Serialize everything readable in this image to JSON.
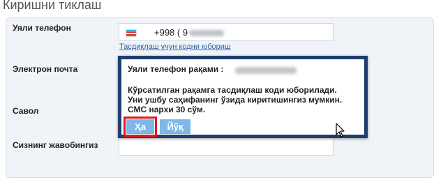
{
  "page": {
    "title": "Киришни тиклаш"
  },
  "form": {
    "phone_label": "Уяли телефон",
    "phone_prefix": "+998 ( 9",
    "resend_link": "Тасдиқлаш учун кодни юбориш",
    "email_label": "Электрон почта",
    "question_label": "Савол",
    "answer_label": "Сизнинг жавобингиз",
    "flag_icon": "uzbekistan-flag-icon"
  },
  "dialog": {
    "title": "Уяли телефон рақами :",
    "message_lines": [
      "Кўрсатилган рақамга тасдиқлаш коди юборилади.",
      "Уни ушбу саҳифанинг ўзида киритишингиз мумкин.",
      "СМС нархи 30 сўм."
    ],
    "yes_button": "Ҳа",
    "no_button": "Йўқ"
  },
  "colors": {
    "dialog_border": "#1f3e6e",
    "button": "#7db8e8",
    "highlight": "#e0191d",
    "link": "#2a63a6"
  }
}
